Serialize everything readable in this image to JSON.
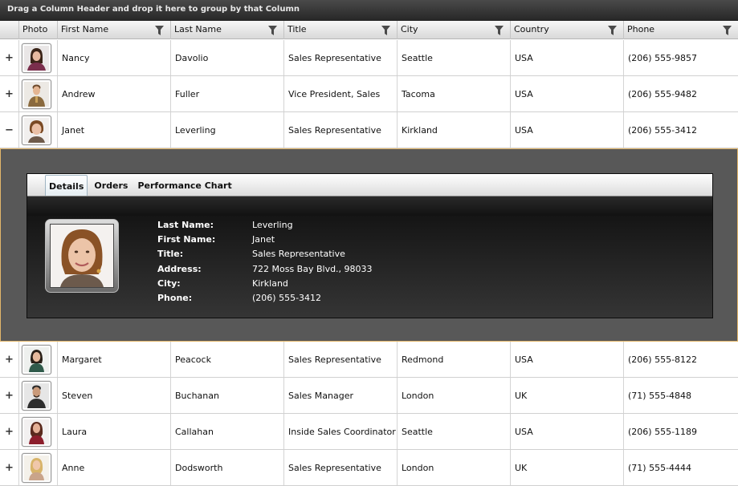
{
  "group_panel_text": "Drag a Column Header and drop it here to group by that Column",
  "columns": [
    {
      "label": "Photo"
    },
    {
      "label": "First Name"
    },
    {
      "label": "Last Name"
    },
    {
      "label": "Title"
    },
    {
      "label": "City"
    },
    {
      "label": "Country"
    },
    {
      "label": "Phone"
    }
  ],
  "rows": [
    {
      "toggle": "+",
      "first": "Nancy",
      "last": "Davolio",
      "title": "Sales Representative",
      "city": "Seattle",
      "country": "USA",
      "phone": "(206) 555-9857"
    },
    {
      "toggle": "+",
      "first": "Andrew",
      "last": "Fuller",
      "title": "Vice President, Sales",
      "city": "Tacoma",
      "country": "USA",
      "phone": "(206) 555-9482"
    },
    {
      "toggle": "−",
      "first": "Janet",
      "last": "Leverling",
      "title": "Sales Representative",
      "city": "Kirkland",
      "country": "USA",
      "phone": "(206) 555-3412"
    },
    {
      "toggle": "+",
      "first": "Margaret",
      "last": "Peacock",
      "title": "Sales Representative",
      "city": "Redmond",
      "country": "USA",
      "phone": "(206) 555-8122"
    },
    {
      "toggle": "+",
      "first": "Steven",
      "last": "Buchanan",
      "title": "Sales Manager",
      "city": "London",
      "country": "UK",
      "phone": "(71) 555-4848"
    },
    {
      "toggle": "+",
      "first": "Laura",
      "last": "Callahan",
      "title": "Inside Sales Coordinator",
      "city": "Seattle",
      "country": "USA",
      "phone": "(206) 555-1189"
    },
    {
      "toggle": "+",
      "first": "Anne",
      "last": "Dodsworth",
      "title": "Sales Representative",
      "city": "London",
      "country": "UK",
      "phone": "(71) 555-4444"
    }
  ],
  "details": {
    "tabs": [
      {
        "label": "Details"
      },
      {
        "label": "Orders"
      },
      {
        "label": "Performance Chart"
      }
    ],
    "fields": [
      {
        "label": "Last Name:",
        "value": "Leverling"
      },
      {
        "label": "First Name:",
        "value": "Janet"
      },
      {
        "label": "Title:",
        "value": "Sales Representative"
      },
      {
        "label": "Address:",
        "value": "722 Moss Bay Blvd., 98033"
      },
      {
        "label": "City:",
        "value": "Kirkland"
      },
      {
        "label": "Phone:",
        "value": "(206) 555-3412"
      }
    ]
  },
  "colors": {
    "accent_border": "#e3b76b",
    "details_background": "#585858",
    "panel_background": "#1e1e1e"
  },
  "icons": {
    "expand": "plus-icon",
    "collapse": "minus-icon",
    "filter": "filter-icon"
  }
}
